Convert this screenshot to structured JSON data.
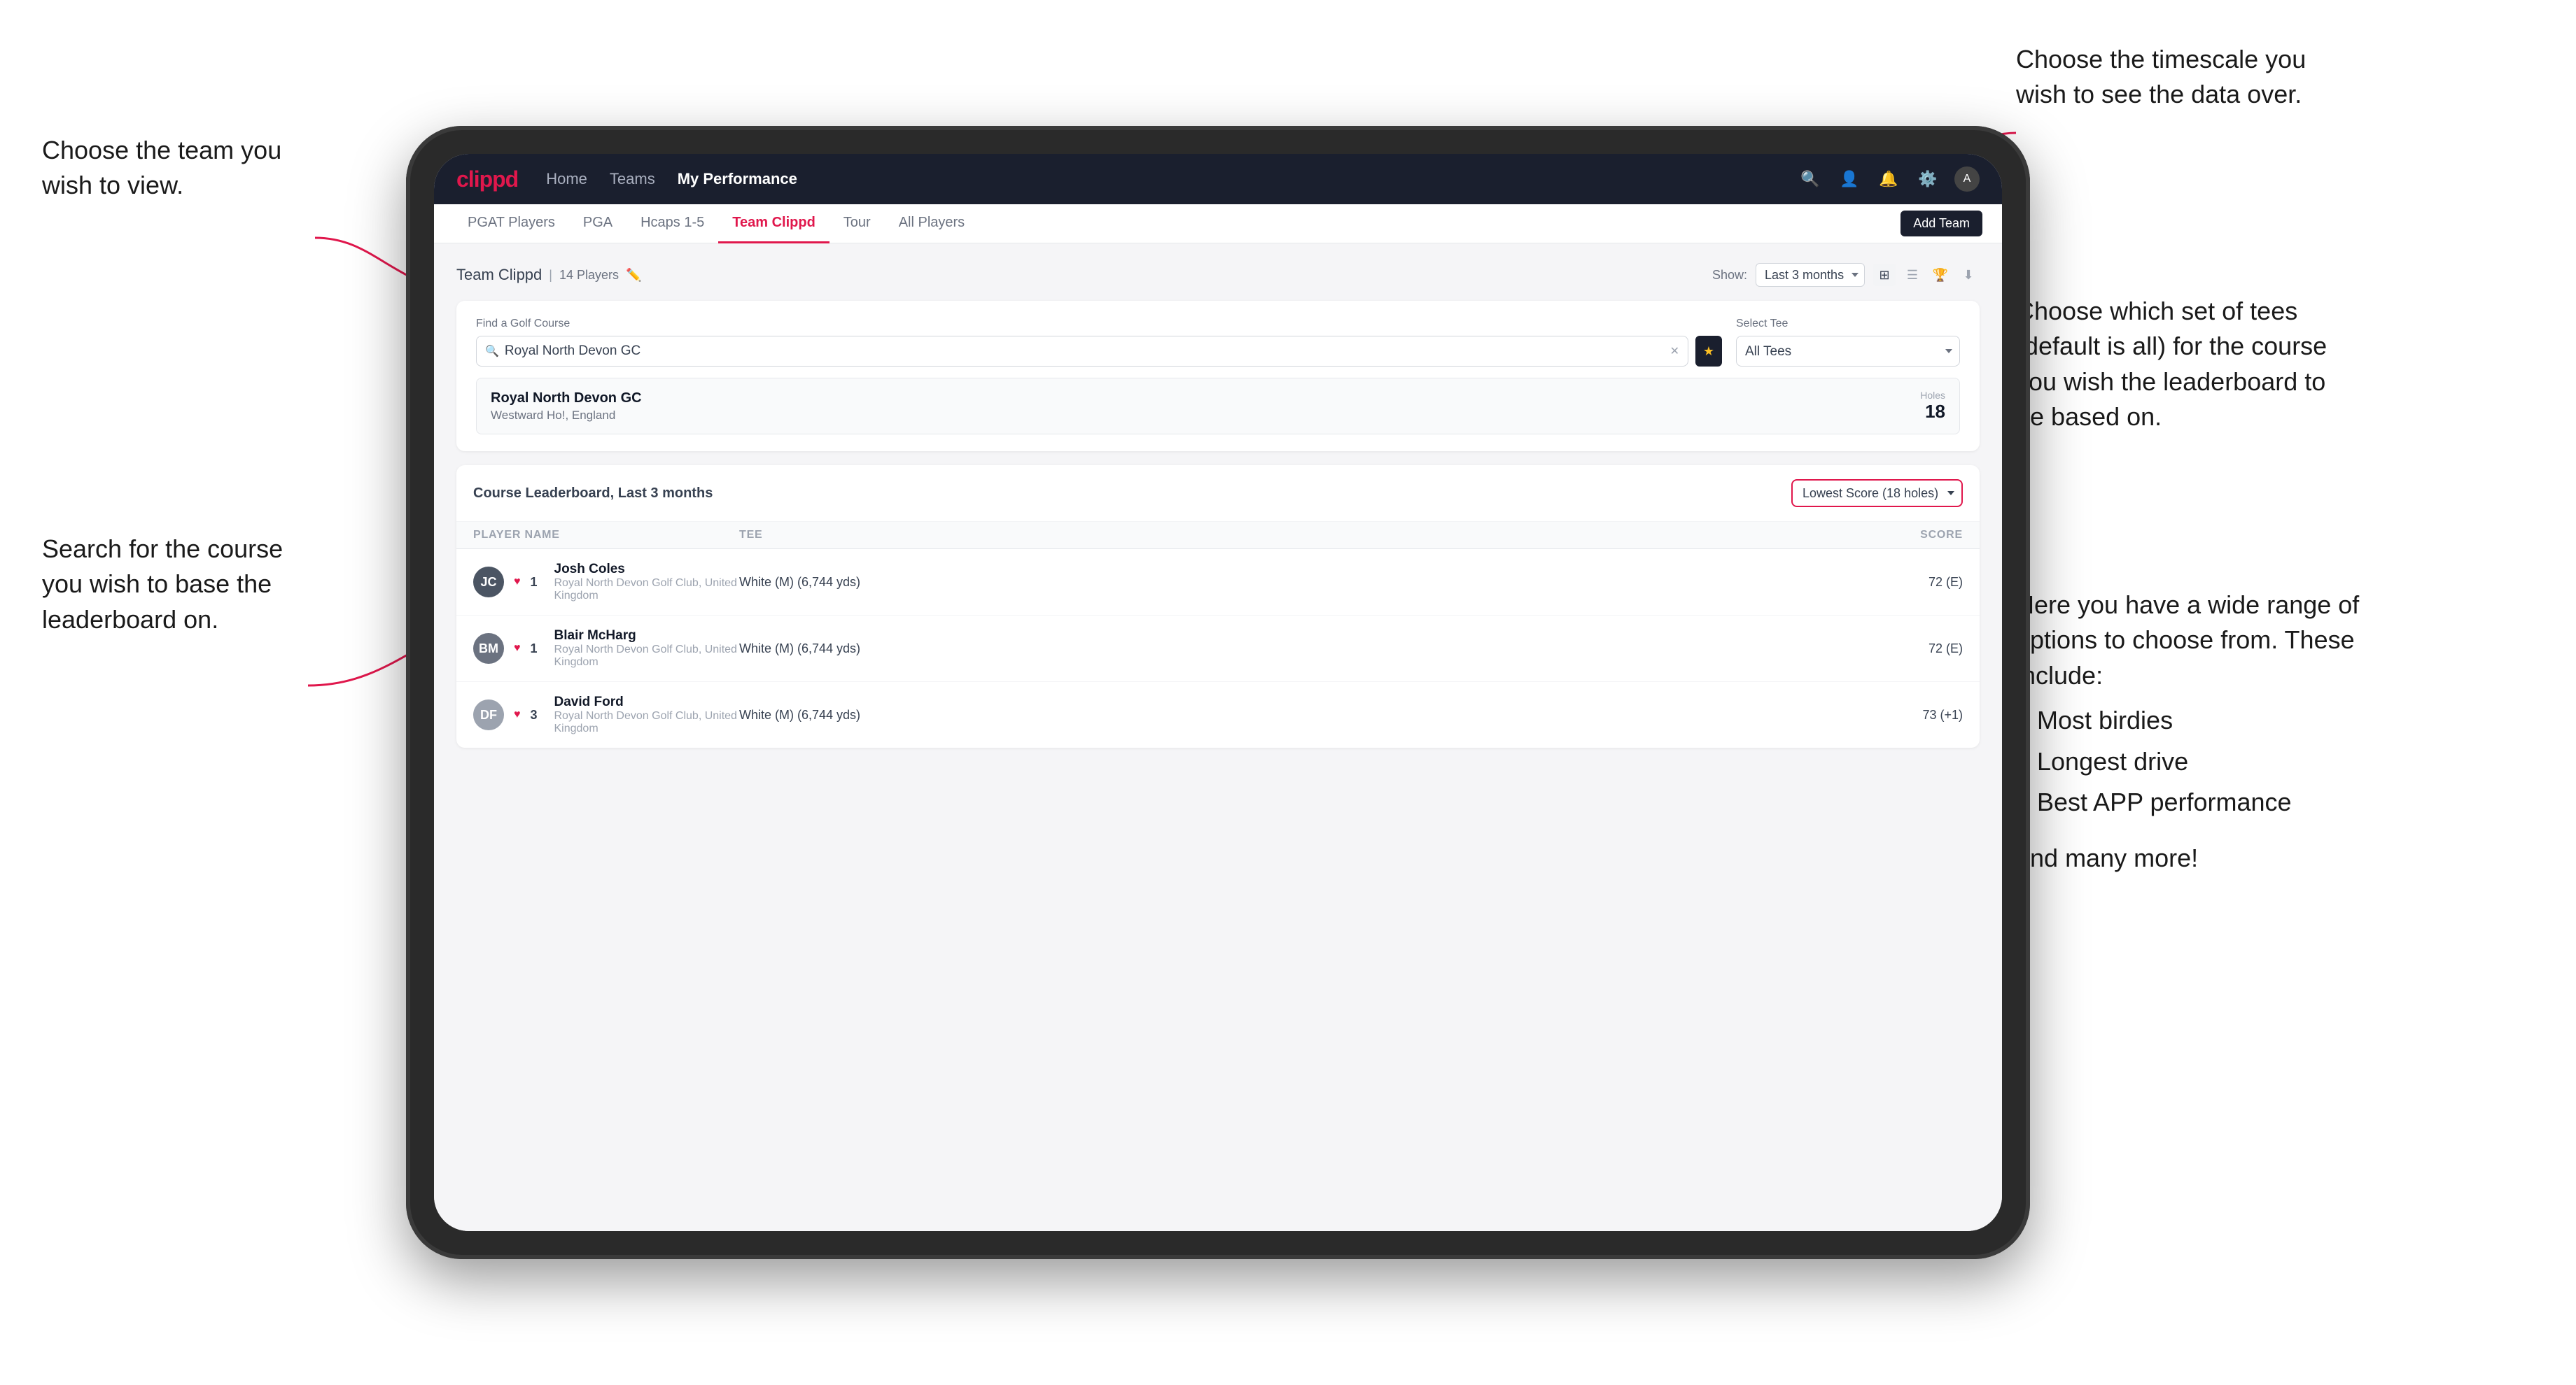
{
  "annotations": {
    "top_left": {
      "title": "Choose the team you wish to view."
    },
    "top_right": {
      "title": "Choose the timescale you wish to see the data over."
    },
    "mid_right": {
      "title": "Choose which set of tees (default is all) for the course you wish the leaderboard to be based on."
    },
    "mid_left": {
      "title": "Search for the course you wish to base the leaderboard on."
    },
    "bot_right": {
      "title": "Here you have a wide range of options to choose from. These include:",
      "list": [
        "Most birdies",
        "Longest drive",
        "Best APP performance"
      ],
      "more": "and many more!"
    }
  },
  "navbar": {
    "logo": "clippd",
    "nav_items": [
      "Home",
      "Teams",
      "My Performance"
    ],
    "active_nav": "My Performance"
  },
  "subnav": {
    "items": [
      "PGAT Players",
      "PGA",
      "Hcaps 1-5",
      "Team Clippd",
      "Tour",
      "All Players"
    ],
    "active": "Team Clippd",
    "add_team_label": "Add Team"
  },
  "team_header": {
    "title": "Team Clippd",
    "player_count": "14 Players",
    "show_label": "Show:",
    "show_value": "Last 3 months"
  },
  "search_section": {
    "find_label": "Find a Golf Course",
    "search_value": "Royal North Devon GC",
    "tee_label": "Select Tee",
    "tee_value": "All Tees"
  },
  "course_result": {
    "name": "Royal North Devon GC",
    "location": "Westward Ho!, England",
    "holes_label": "Holes",
    "holes": "18"
  },
  "leaderboard": {
    "title": "Course Leaderboard,",
    "period": "Last 3 months",
    "score_option": "Lowest Score (18 holes)",
    "columns": {
      "player": "PLAYER NAME",
      "tee": "TEE",
      "score": "SCORE"
    },
    "rows": [
      {
        "rank": "1",
        "name": "Josh Coles",
        "club": "Royal North Devon Golf Club, United Kingdom",
        "tee": "White (M) (6,744 yds)",
        "score": "72 (E)",
        "avatar_initials": "JC",
        "avatar_class": "av-1"
      },
      {
        "rank": "1",
        "name": "Blair McHarg",
        "club": "Royal North Devon Golf Club, United Kingdom",
        "tee": "White (M) (6,744 yds)",
        "score": "72 (E)",
        "avatar_initials": "BM",
        "avatar_class": "av-2"
      },
      {
        "rank": "3",
        "name": "David Ford",
        "club": "Royal North Devon Golf Club, United Kingdom",
        "tee": "White (M) (6,744 yds)",
        "score": "73 (+1)",
        "avatar_initials": "DF",
        "avatar_class": "av-3"
      }
    ]
  }
}
